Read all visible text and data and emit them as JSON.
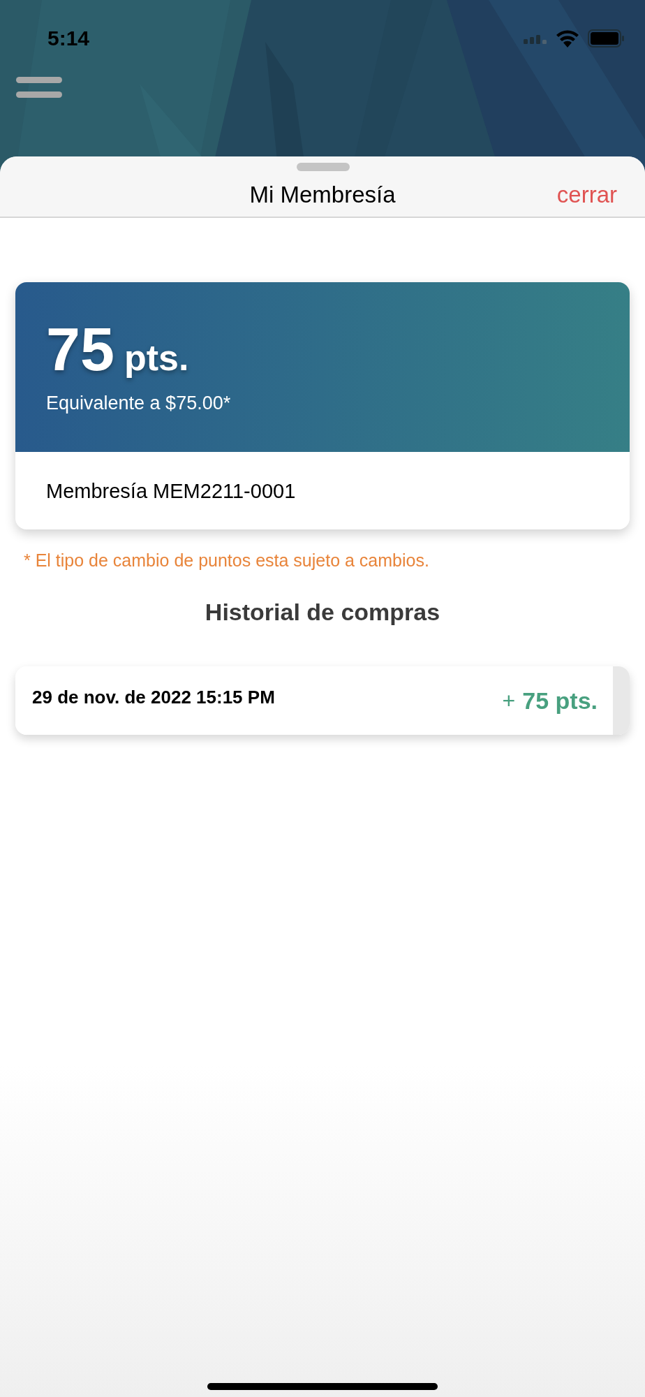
{
  "status_bar": {
    "time": "5:14"
  },
  "sheet": {
    "title": "Mi Membresía",
    "close_label": "cerrar"
  },
  "membership_card": {
    "points": "75",
    "points_unit": "pts.",
    "equivalent": "Equivalente a $75.00*",
    "membership": "Membresía MEM2211-0001"
  },
  "disclaimer": "* El tipo de cambio de puntos esta sujeto a cambios.",
  "history": {
    "title": "Historial de compras",
    "entries": [
      {
        "date": "29 de nov. de 2022 15:15 PM",
        "sign": "+",
        "amount": "75 pts."
      }
    ]
  }
}
